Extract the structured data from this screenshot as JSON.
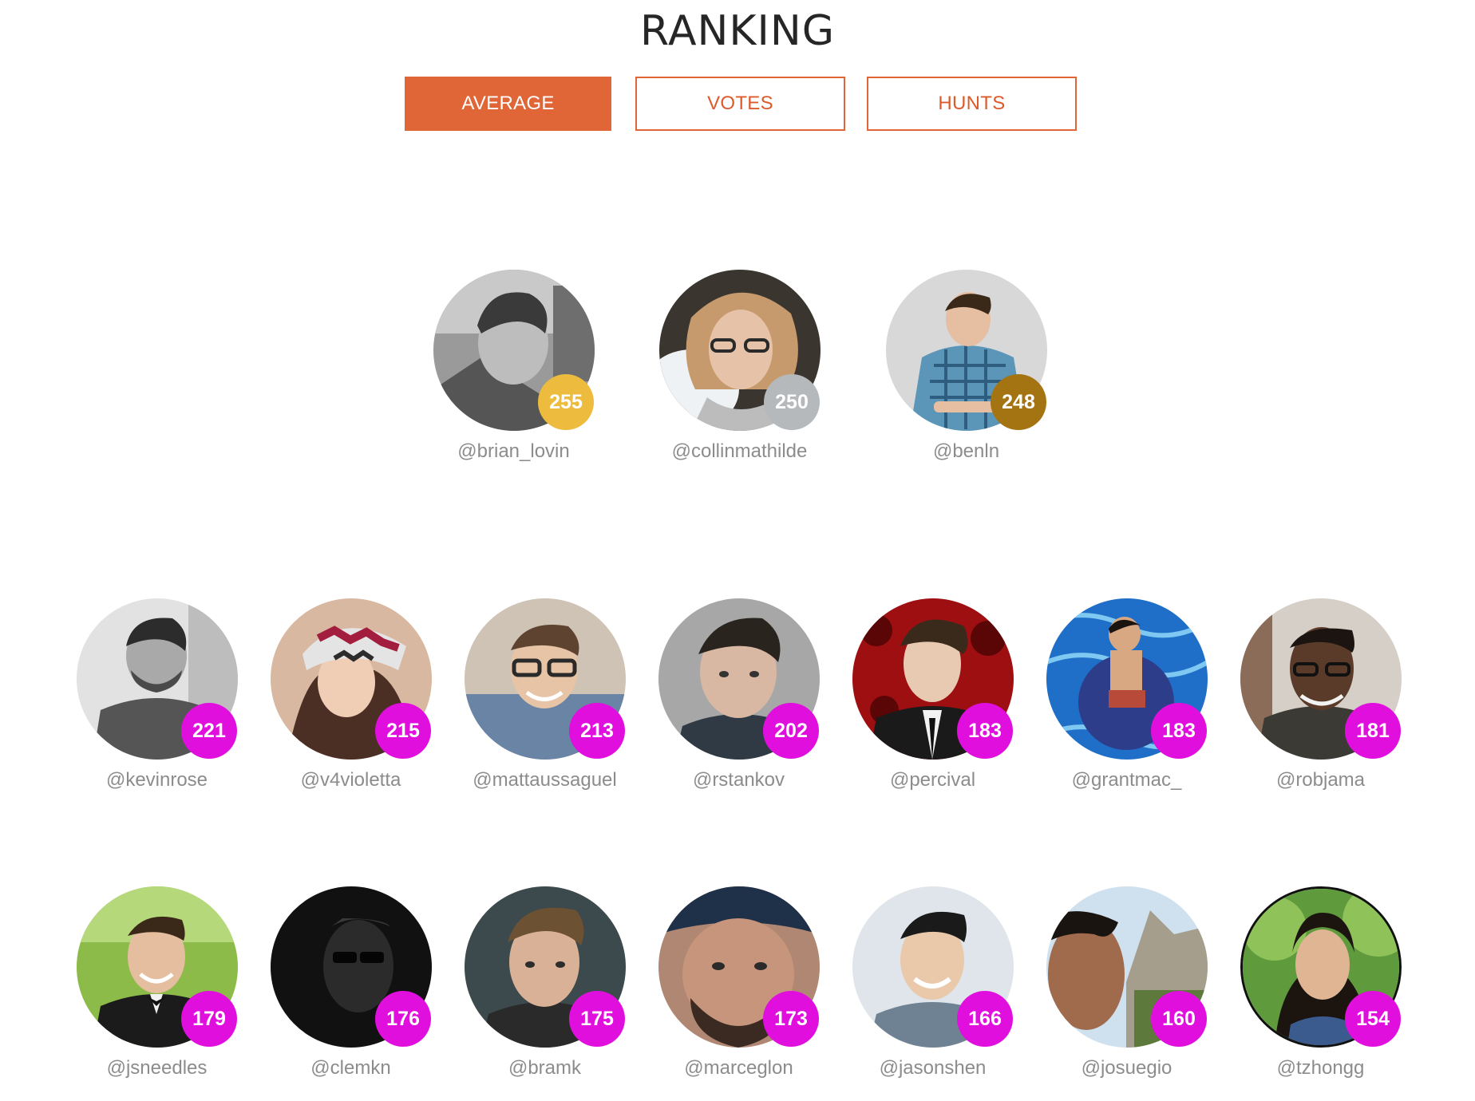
{
  "page": {
    "title": "RANKING"
  },
  "tabs": [
    {
      "label": "AVERAGE",
      "active": true
    },
    {
      "label": "VOTES",
      "active": false
    },
    {
      "label": "HUNTS",
      "active": false
    }
  ],
  "colors": {
    "accent": "#e06537",
    "badge_gold": "#edbb3e",
    "badge_silver": "#b5b9bc",
    "badge_bronze": "#a57412",
    "badge_default": "#e10fde",
    "handle_text": "#8c8c8c",
    "title_text": "#262626"
  },
  "podium": [
    {
      "handle": "@brian_lovin",
      "score": "255",
      "medal": "gold"
    },
    {
      "handle": "@collinmathilde",
      "score": "250",
      "medal": "silver"
    },
    {
      "handle": "@benln",
      "score": "248",
      "medal": "bronze"
    }
  ],
  "ranking_row_1": [
    {
      "handle": "@kevinrose",
      "score": "221"
    },
    {
      "handle": "@v4violetta",
      "score": "215"
    },
    {
      "handle": "@mattaussaguel",
      "score": "213"
    },
    {
      "handle": "@rstankov",
      "score": "202"
    },
    {
      "handle": "@percival",
      "score": "183"
    },
    {
      "handle": "@grantmac_",
      "score": "183"
    },
    {
      "handle": "@robjama",
      "score": "181"
    }
  ],
  "ranking_row_2": [
    {
      "handle": "@jsneedles",
      "score": "179"
    },
    {
      "handle": "@clemkn",
      "score": "176"
    },
    {
      "handle": "@bramk",
      "score": "175"
    },
    {
      "handle": "@marceglon",
      "score": "173"
    },
    {
      "handle": "@jasonshen",
      "score": "166"
    },
    {
      "handle": "@josuegio",
      "score": "160"
    },
    {
      "handle": "@tzhongg",
      "score": "154"
    }
  ]
}
